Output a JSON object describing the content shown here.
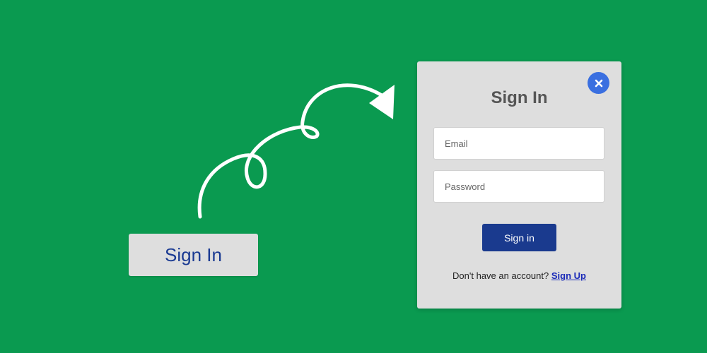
{
  "trigger": {
    "label": "Sign In"
  },
  "modal": {
    "title": "Sign In",
    "close_symbol": "×",
    "email": {
      "placeholder": "Email",
      "value": ""
    },
    "password": {
      "placeholder": "Password",
      "value": ""
    },
    "submit_label": "Sign in",
    "footer_text": "Don't have an account?",
    "signup_label": "Sign Up"
  },
  "icons": {
    "arrow": "curly-arrow-icon",
    "close": "close-icon"
  },
  "colors": {
    "background": "#0a9a50",
    "panel": "#dedede",
    "title": "#555555",
    "primary": "#1a3a8e",
    "close": "#3a6fe0",
    "link": "#1a2ab8",
    "trigger_text": "#1a3a92"
  }
}
